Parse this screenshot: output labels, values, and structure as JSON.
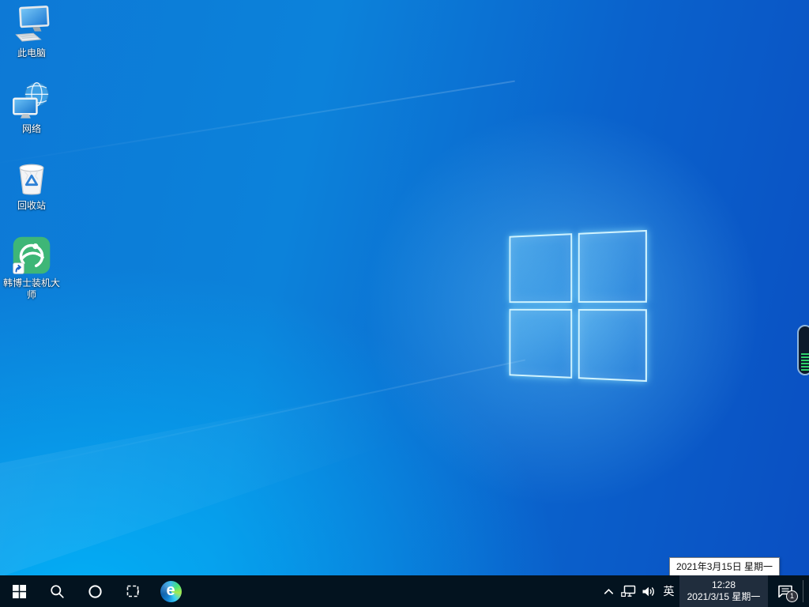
{
  "colors": {
    "taskbar_bg": "#03131f",
    "clock_highlight": "#20:2d3d",
    "wallpaper_cyan": "#00aaf2",
    "wallpaper_deep_blue": "#0a4fc2",
    "volume_meter_green": "#2ed06a",
    "hanboshi_green": "#3eb677"
  },
  "desktop": {
    "icons": [
      {
        "name": "this-pc",
        "label": "此电脑"
      },
      {
        "name": "network",
        "label": "网络"
      },
      {
        "name": "recycle-bin",
        "label": "回收站"
      },
      {
        "name": "hanboshi-installer",
        "label": "韩博士装机大师"
      }
    ]
  },
  "volume_indicator": {
    "lit_segments": 6
  },
  "tooltip": {
    "text": "2021年3月15日 星期一"
  },
  "taskbar": {
    "language_indicator": "英",
    "clock": {
      "time": "12:28",
      "date": "2021/3/15 星期一"
    },
    "notification_badge": "1",
    "edge_letter": "e",
    "icons": {
      "start": "windows-flag",
      "search": "magnifier",
      "cortana": "ring",
      "task_view": "dashed-square",
      "edge": "edge-swirl",
      "tray_expand": "chevron-up",
      "network": "monitor-ethernet",
      "volume": "speaker-waves",
      "action_center": "speech-bubble"
    }
  }
}
